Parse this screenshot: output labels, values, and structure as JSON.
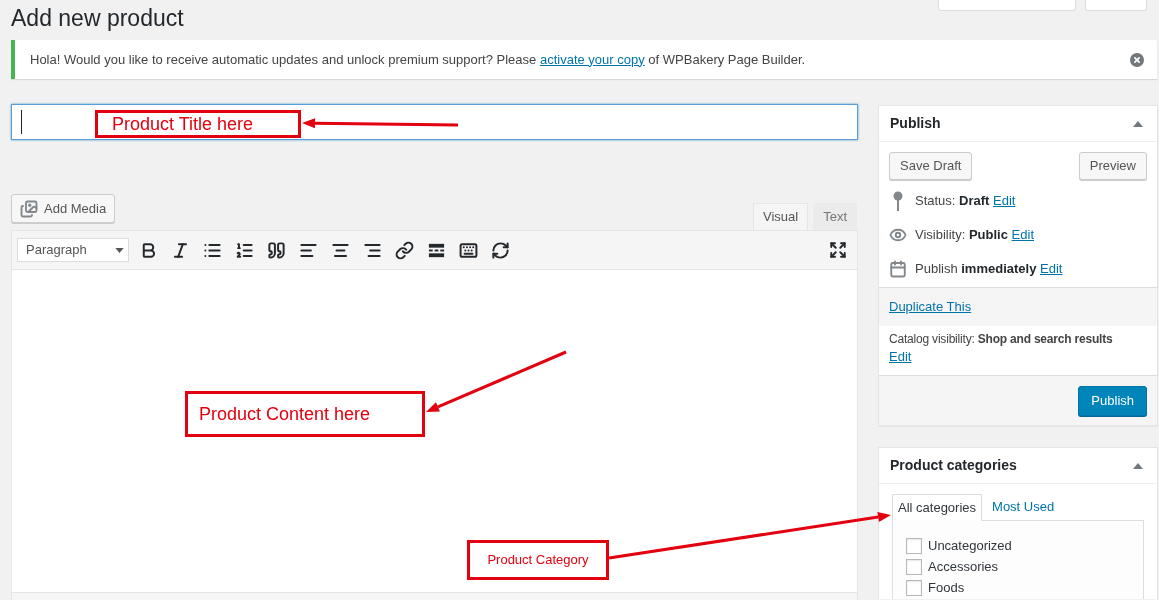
{
  "page": {
    "title": "Add new product"
  },
  "notice": {
    "text_before": "Hola! Would you like to receive automatic updates and unlock premium support? Please",
    "link": "activate your copy",
    "text_after": "of WPBakery Page Builder."
  },
  "title_field": {
    "focused": true
  },
  "editor": {
    "add_media": "Add Media",
    "tabs": [
      {
        "label": "Visual",
        "selected": true
      },
      {
        "label": "Text",
        "selected": false
      }
    ],
    "format_select": "Paragraph"
  },
  "publish": {
    "title": "Publish",
    "save_draft": "Save Draft",
    "preview": "Preview",
    "rows": [
      {
        "text": "Status: **Draft**",
        "link": "Edit"
      },
      {
        "text": "Visibility: **Public**",
        "link": "Edit"
      },
      {
        "text": "Publish **immediately**",
        "link": "Edit"
      }
    ],
    "duplicate_link": "Duplicate This",
    "catalog": {
      "text": "Catalog visibility: **Shop and search results**",
      "link": "Edit"
    },
    "publish_button": "Publish"
  },
  "categories": {
    "title": "Product categories",
    "tabs": [
      {
        "label": "All categories",
        "selected": true
      },
      {
        "label": "Most Used",
        "selected": false
      }
    ],
    "items": [
      {
        "label": "Uncategorized",
        "checked": false
      },
      {
        "label": "Accessories",
        "checked": false
      },
      {
        "label": "Foods",
        "checked": false
      }
    ]
  },
  "annotations": [
    {
      "text": "Product Title here"
    },
    {
      "text": "Product Content here"
    },
    {
      "text": "Product Category"
    }
  ]
}
